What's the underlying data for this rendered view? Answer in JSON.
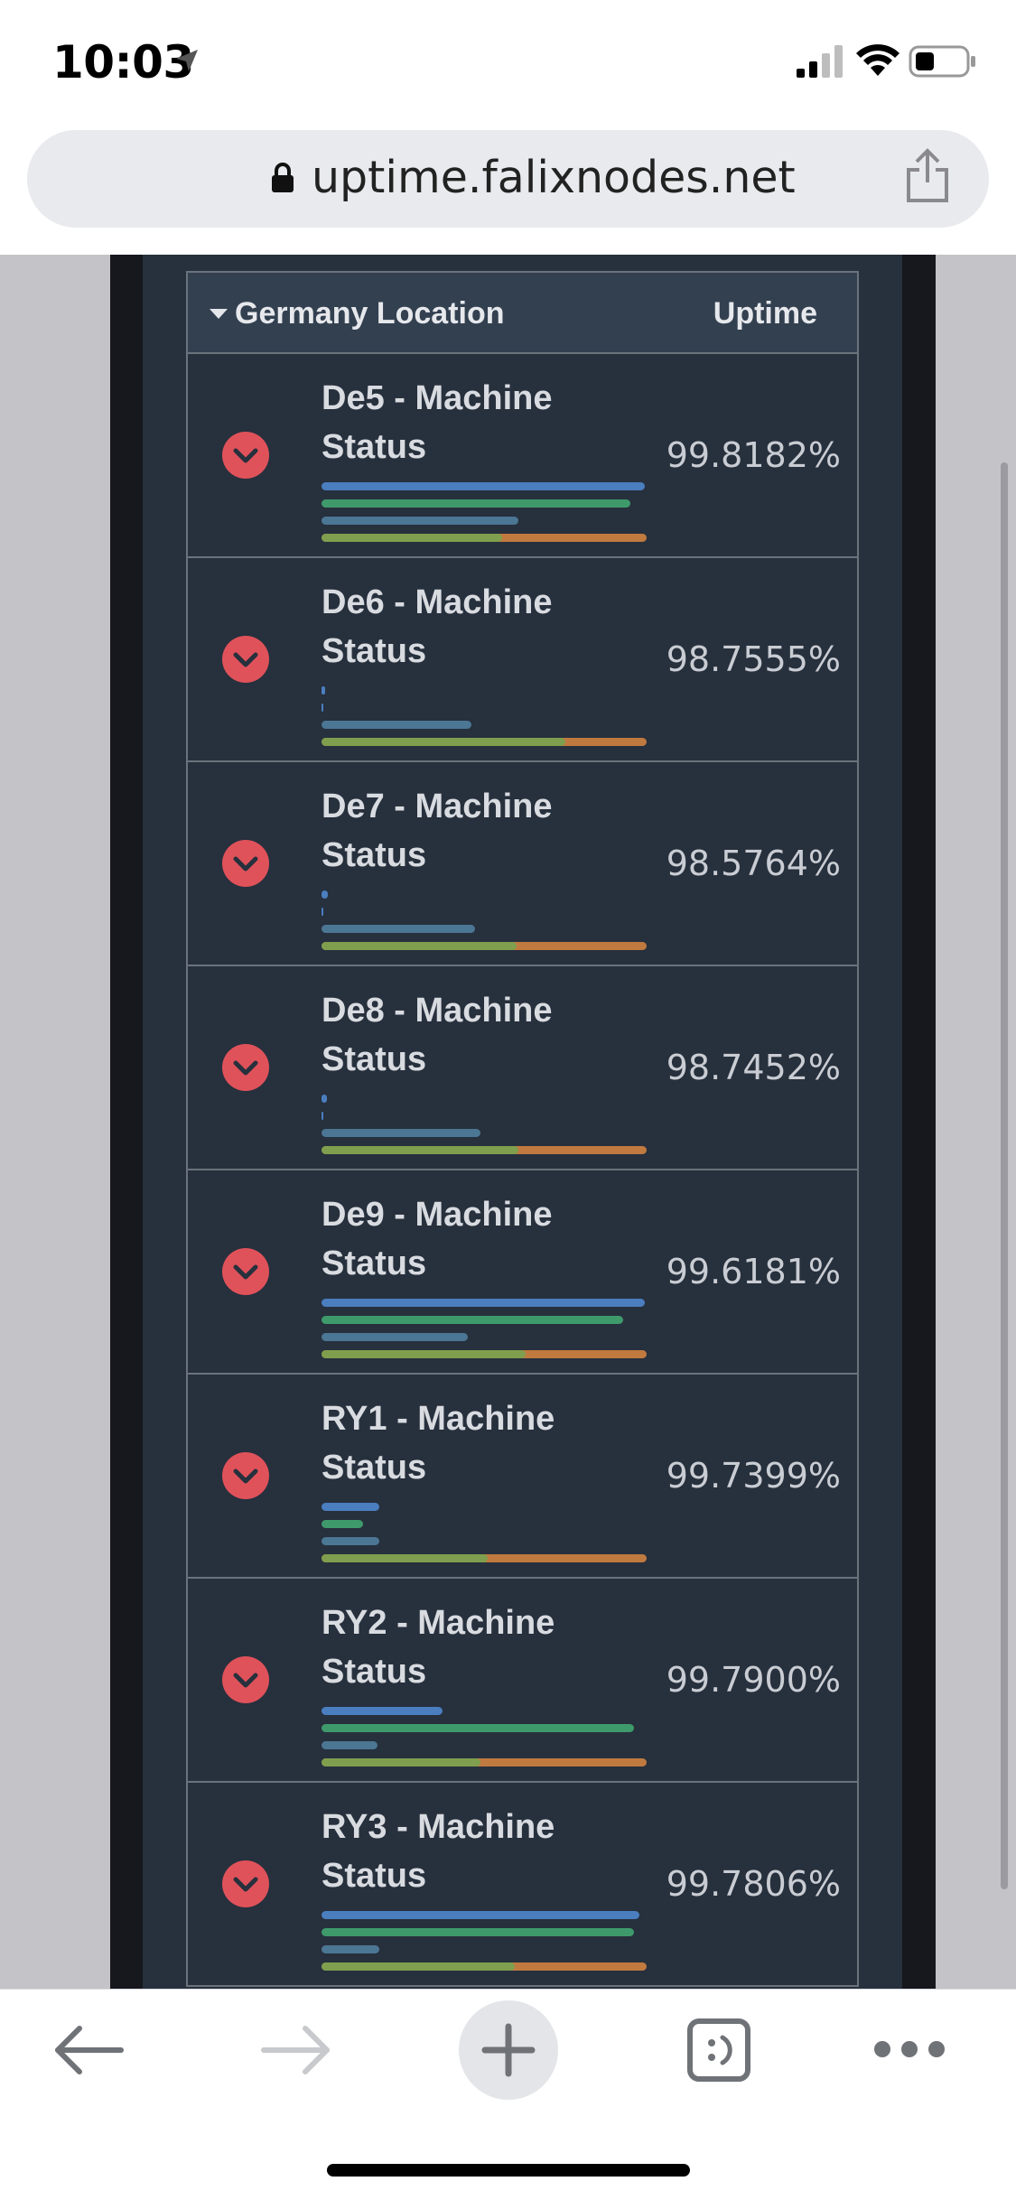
{
  "status_bar": {
    "time": "10:03",
    "icons": [
      "location-arrow-icon",
      "cellular-signal-icon",
      "wifi-icon",
      "battery-icon"
    ]
  },
  "browser": {
    "url": "uptime.falixnodes.net",
    "icons": [
      "lock-icon",
      "share-icon"
    ]
  },
  "table": {
    "location_header": "Germany Location",
    "uptime_header": "Uptime",
    "rows": [
      {
        "name": "De5 - Machine Status",
        "uptime": "99.8182%"
      },
      {
        "name": "De6 - Machine Status",
        "uptime": "98.7555%"
      },
      {
        "name": "De7 - Machine Status",
        "uptime": "98.5764%"
      },
      {
        "name": "De8 - Machine Status",
        "uptime": "98.7452%"
      },
      {
        "name": "De9 - Machine Status",
        "uptime": "99.6181%"
      },
      {
        "name": "RY1 - Machine Status",
        "uptime": "99.7399%"
      },
      {
        "name": "RY2 - Machine Status",
        "uptime": "99.7900%"
      },
      {
        "name": "RY3 - Machine Status",
        "uptime": "99.7806%"
      }
    ]
  },
  "colors": {
    "status_down": "#e0525a",
    "panel_bg": "#27303d",
    "bar_blue": "#4a7ebf",
    "bar_green": "#3f9a6b",
    "bar_teal": "#4b7694",
    "bar_orange": "#c07a3f",
    "bar_olive": "#7f9f4e"
  },
  "toolbar": {
    "icons": [
      "back-arrow-icon",
      "forward-arrow-icon",
      "new-tab-plus-icon",
      "tabs-icon",
      "more-icon"
    ]
  }
}
